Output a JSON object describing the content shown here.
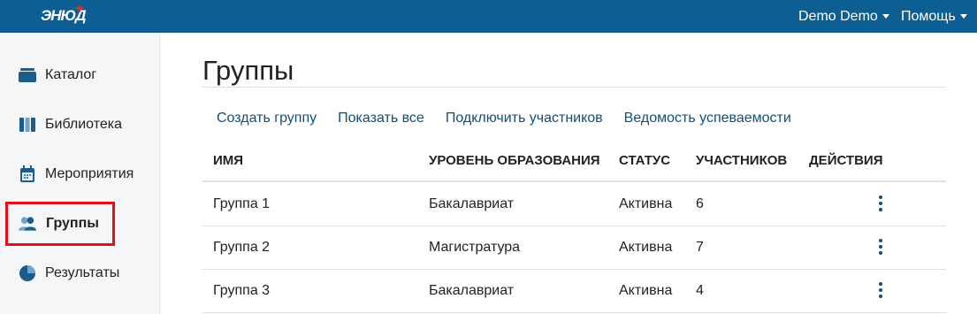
{
  "header": {
    "logo_text": "ЭНЮД",
    "user_menu": "Demo Demo",
    "help_menu": "Помощь"
  },
  "colors": {
    "topbar": "#0d5f93",
    "link": "#124e78",
    "active_border": "#e3101a"
  },
  "sidebar": {
    "items": [
      {
        "label": "Каталог",
        "icon": "catalog-icon"
      },
      {
        "label": "Библиотека",
        "icon": "library-icon"
      },
      {
        "label": "Мероприятия",
        "icon": "calendar-icon"
      },
      {
        "label": "Группы",
        "icon": "users-icon",
        "active": true
      },
      {
        "label": "Результаты",
        "icon": "pie-chart-icon"
      }
    ]
  },
  "main": {
    "title": "Группы",
    "actions": [
      "Создать группу",
      "Показать все",
      "Подключить участников",
      "Ведомость успеваемости"
    ],
    "table": {
      "columns": [
        "Имя",
        "Уровень образования",
        "Статус",
        "Участников",
        "Действия"
      ],
      "rows": [
        {
          "name": "Группа 1",
          "level": "Бакалавриат",
          "status": "Активна",
          "members": "6"
        },
        {
          "name": "Группа 2",
          "level": "Магистратура",
          "status": "Активна",
          "members": "7"
        },
        {
          "name": "Группа 3",
          "level": "Бакалавриат",
          "status": "Активна",
          "members": "4"
        }
      ]
    }
  }
}
